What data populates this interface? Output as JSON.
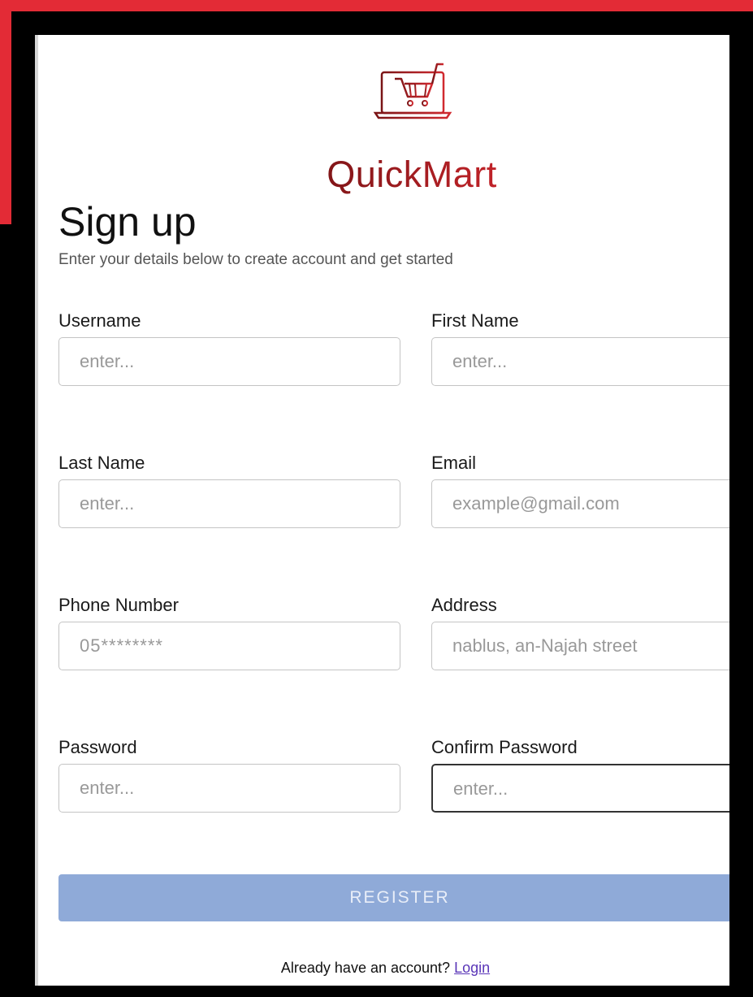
{
  "brand": {
    "name": "QuickMart",
    "icon": "shopping-cart-laptop-icon",
    "colors": {
      "dark": "#7a1416",
      "light": "#c8242a"
    }
  },
  "page": {
    "title": "Sign up",
    "subtitle": "Enter your details below to create account and get started"
  },
  "form": {
    "username": {
      "label": "Username",
      "placeholder": "enter..."
    },
    "first_name": {
      "label": "First Name",
      "placeholder": "enter..."
    },
    "last_name": {
      "label": "Last Name",
      "placeholder": "enter..."
    },
    "email": {
      "label": "Email",
      "placeholder": "example@gmail.com"
    },
    "phone": {
      "label": "Phone Number",
      "placeholder": "05********"
    },
    "address": {
      "label": "Address",
      "placeholder": "nablus, an-Najah street"
    },
    "password": {
      "label": "Password",
      "placeholder": "enter..."
    },
    "confirm_password": {
      "label": "Confirm Password",
      "placeholder": "enter..."
    },
    "register_label": "REGISTER"
  },
  "footer": {
    "prompt": "Already have an account?",
    "login_label": "Login"
  },
  "colors": {
    "background_red": "#e32b36",
    "register_button": "#8faad8",
    "link": "#5a36b8"
  }
}
